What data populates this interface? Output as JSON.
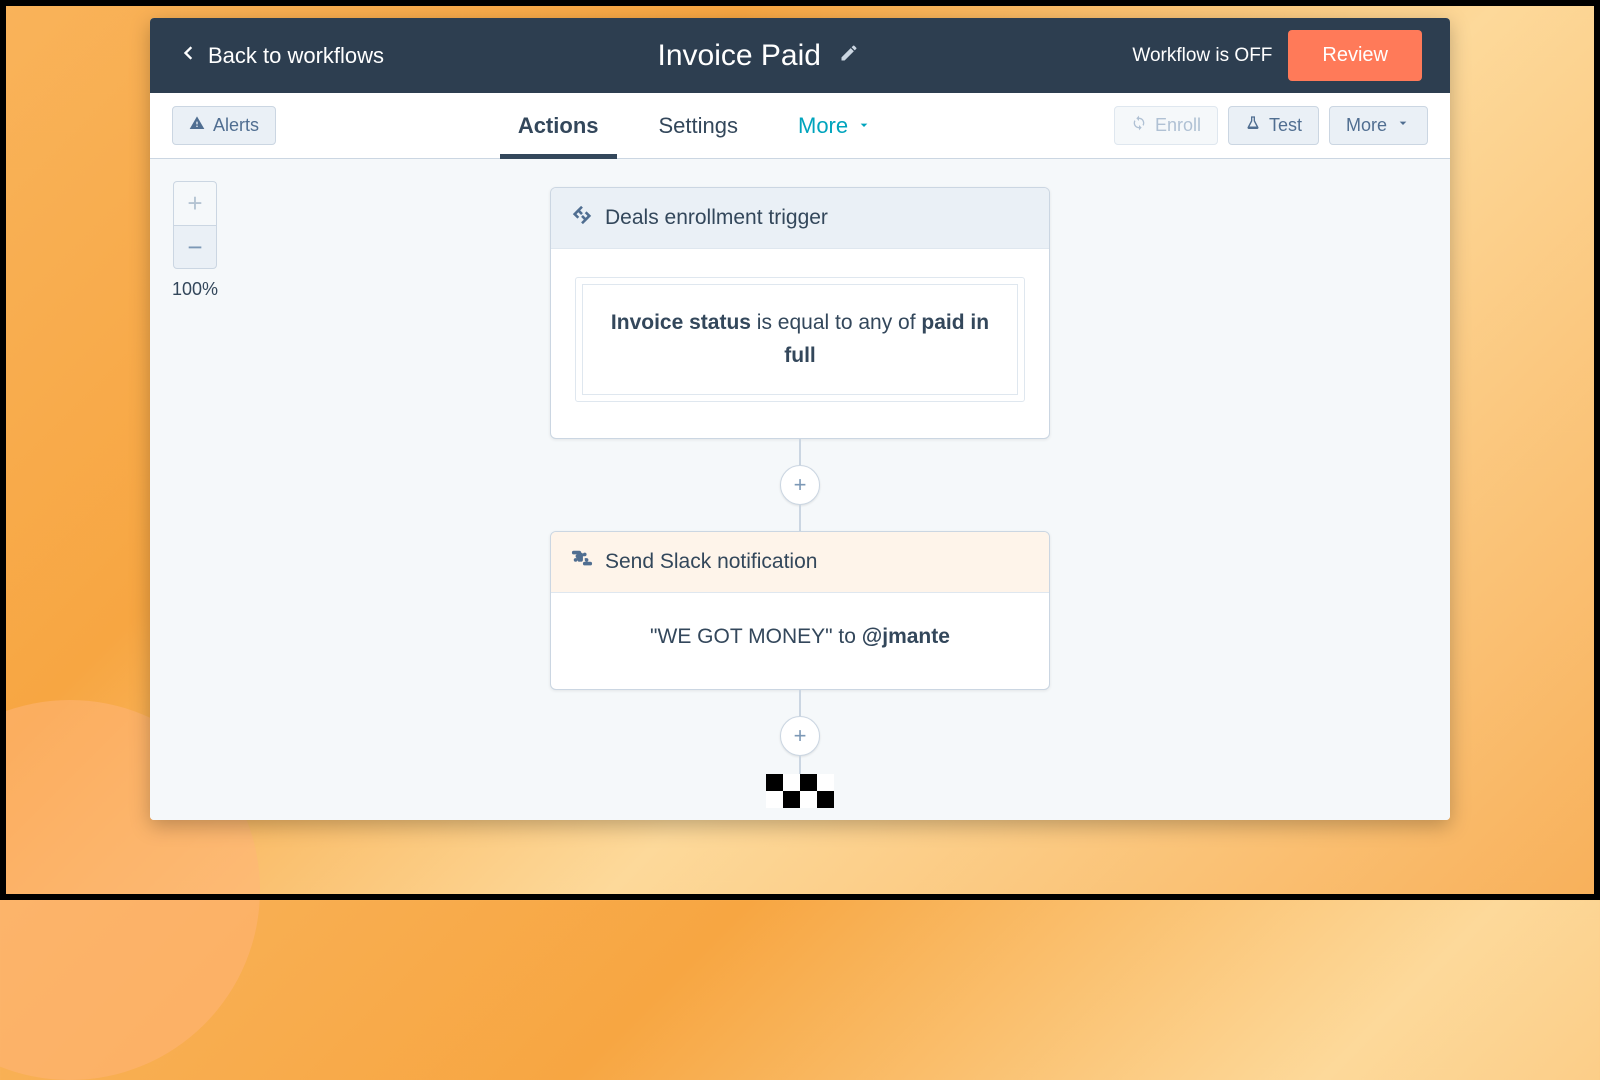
{
  "header": {
    "back_label": "Back to workflows",
    "title": "Invoice Paid",
    "status": "Workflow is OFF",
    "review_label": "Review"
  },
  "toolbar": {
    "alerts_label": "Alerts",
    "tabs": {
      "actions": "Actions",
      "settings": "Settings",
      "more": "More"
    },
    "enroll_label": "Enroll",
    "test_label": "Test",
    "more_label": "More"
  },
  "zoom": {
    "level": "100%"
  },
  "trigger": {
    "title": "Deals enrollment trigger",
    "field": "Invoice status",
    "op": " is equal to any of ",
    "value": "paid in full"
  },
  "action": {
    "title": "Send Slack notification",
    "message": "\"WE GOT MONEY\"",
    "joiner": " to ",
    "recipient": "@jmante"
  }
}
